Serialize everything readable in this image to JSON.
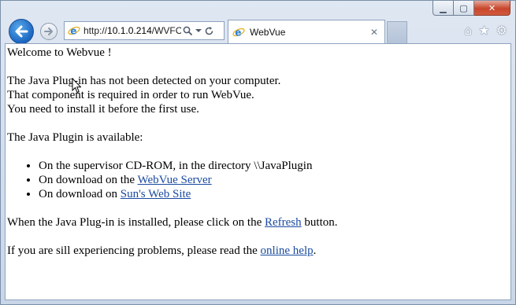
{
  "browser": {
    "address": {
      "prefix": "http://",
      "host": "10.1.0.214",
      "path": "/WVFO"
    },
    "tab": {
      "title": "WebVue",
      "close": "✕"
    },
    "caption": {
      "minimize": "▁",
      "maximize": "▢",
      "close": "✕"
    },
    "icons": {
      "back": "back-arrow-icon",
      "forward": "forward-arrow-icon",
      "search": "search-icon",
      "dropdown": "dropdown-icon",
      "refresh": "refresh-icon",
      "home": "⌂",
      "favorites": "★",
      "tools": "⚙"
    }
  },
  "page": {
    "welcome": "Welcome to Webvue !",
    "notice_line1": "The Java Plug-in has not been detected on your computer.",
    "notice_line2": "That component is required in order to run WebVue.",
    "notice_line3": "You need to install it before the first use.",
    "available": "The Java Plugin is available:",
    "sources": [
      {
        "text": "On the supervisor CD-ROM, in the directory \\\\JavaPlugin",
        "link": ""
      },
      {
        "text": "On download on the ",
        "link": "WebVue Server"
      },
      {
        "text": "On download on ",
        "link": "Sun's Web Site"
      }
    ],
    "installed_before": "When the Java Plug-in is installed, please click on the ",
    "refresh_link": "Refresh",
    "installed_after": " button.",
    "problems_before": "If you are sill experiencing problems, please read the ",
    "help_link": "online help",
    "problems_after": "."
  }
}
